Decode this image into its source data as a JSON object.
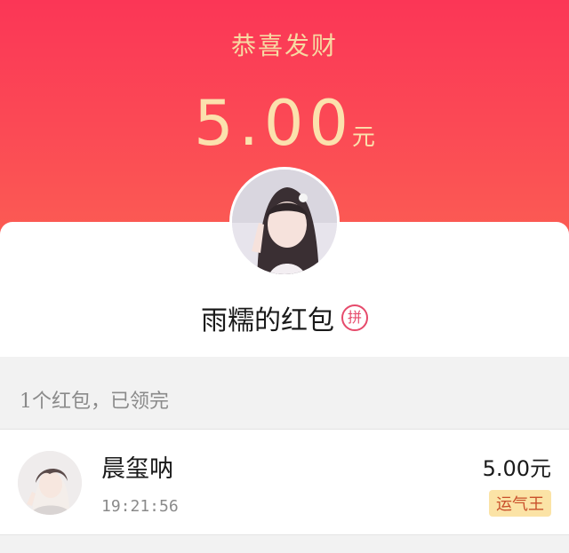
{
  "header": {
    "greeting": "恭喜发财",
    "amount": "5.00",
    "unit": "元"
  },
  "sender": {
    "name": "雨糯的红包",
    "badge": "拼"
  },
  "summary": "1个红包，已领完",
  "recipients": [
    {
      "name": "晨玺呐",
      "time": "19:21:56",
      "amount": "5.00元",
      "tag": "运气王"
    }
  ],
  "colors": {
    "hero": "#fb3656",
    "gold": "#fbe1ad",
    "badge": "#fbe3a6",
    "badge_text": "#c9502b",
    "pin": "#e64a6b"
  }
}
